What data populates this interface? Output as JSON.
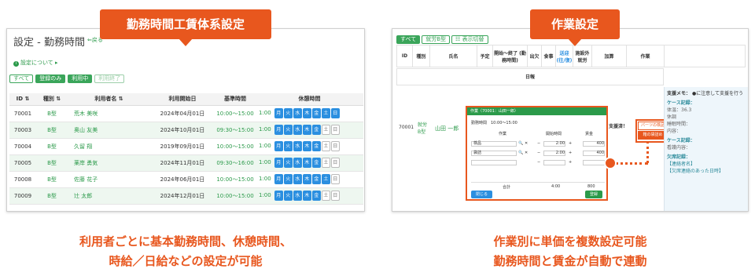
{
  "left_panel": {
    "title": "設定 - 勤務時間",
    "back": "⇐戻る",
    "about": "設定について",
    "filters": [
      "すべて",
      "登録のみ",
      "利用中",
      "利用終了"
    ],
    "columns": [
      "ID",
      "種別",
      "利用者名",
      "利用開始日",
      "基準時間",
      "休憩時間"
    ],
    "days": [
      "月",
      "火",
      "水",
      "木",
      "金",
      "土",
      "日"
    ],
    "rows": [
      {
        "id": "70001",
        "type": "B型",
        "name": "荒木 美咲",
        "start": "2024年04月01日",
        "time": "10:00〜15:00",
        "break": "1:00",
        "off": []
      },
      {
        "id": "70003",
        "type": "B型",
        "name": "奥山 友美",
        "start": "2024年10月01日",
        "time": "09:30〜15:00",
        "break": "1:00",
        "off": [
          "土",
          "日"
        ]
      },
      {
        "id": "70004",
        "type": "B型",
        "name": "久留 翔",
        "start": "2019年09月01日",
        "time": "10:00〜15:00",
        "break": "1:00",
        "off": [
          "土",
          "日"
        ]
      },
      {
        "id": "70005",
        "type": "B型",
        "name": "薬岸 勇気",
        "start": "2024年11月01日",
        "time": "09:30〜16:00",
        "break": "1:00",
        "off": [
          "土",
          "日"
        ]
      },
      {
        "id": "70008",
        "type": "B型",
        "name": "佐藤 花子",
        "start": "2024年06月01日",
        "time": "10:00〜15:00",
        "break": "1:00",
        "off": [
          "日"
        ]
      },
      {
        "id": "70009",
        "type": "B型",
        "name": "辻 太郎",
        "start": "2024年12月01日",
        "time": "10:00〜15:00",
        "break": "1:00",
        "off": [
          "土",
          "日"
        ]
      }
    ]
  },
  "right_panel": {
    "filters": [
      "すべて",
      "就労B型",
      "表示切替"
    ],
    "columns": [
      "ID",
      "種別",
      "氏名",
      "予定",
      "開始〜終了\n(勤務時間)",
      "出欠",
      "食事",
      "送迎\n(往/復)",
      "施設外\n就労",
      "加算",
      "作業"
    ],
    "day_label": "日報",
    "record": {
      "id": "70001",
      "type_line1": "就労",
      "type_line2": "B型",
      "name": "山田 一郎",
      "support": "支援済！"
    },
    "ops": [
      "パーツの検品",
      "箱の袋詰め"
    ],
    "modal": {
      "title": "作業（70001：山田一郎）",
      "time": "勤務時間　10:00〜15:00",
      "headers": [
        "作業",
        "開始時間",
        "賃金"
      ],
      "rows": [
        {
          "task": "検品",
          "start": "2:00",
          "wage": "400"
        },
        {
          "task": "袋詰",
          "start": "2:00",
          "wage": "400"
        }
      ],
      "total_label": "合計",
      "total_start": "4:00",
      "total_wage": "800",
      "close": "閉じる",
      "save": "登録"
    },
    "side": {
      "memo": "支援メモ：",
      "memo_text": "●に注意して支援を行う",
      "case1": "ケース記録：",
      "case1_lines": [
        "体温：36.3",
        "休調",
        "睡眠時間：",
        "内容："
      ],
      "case2": "ケース記録：",
      "case2_lines": [
        "看護内容："
      ],
      "case3": "欠席記録：",
      "case3_lines": [
        "【連絡者名】",
        "",
        "【欠席連絡のあった日時】"
      ]
    }
  },
  "callouts": {
    "left": "勤務時間工賃体系設定",
    "right": "作業設定"
  },
  "captions": {
    "left": [
      "利用者ごとに基本勤務時間、休憩時間、",
      "時給／日給などの設定が可能"
    ],
    "right": [
      "作業別に単価を複数設定可能",
      "勤務時間と賃金が自動で連動"
    ]
  }
}
